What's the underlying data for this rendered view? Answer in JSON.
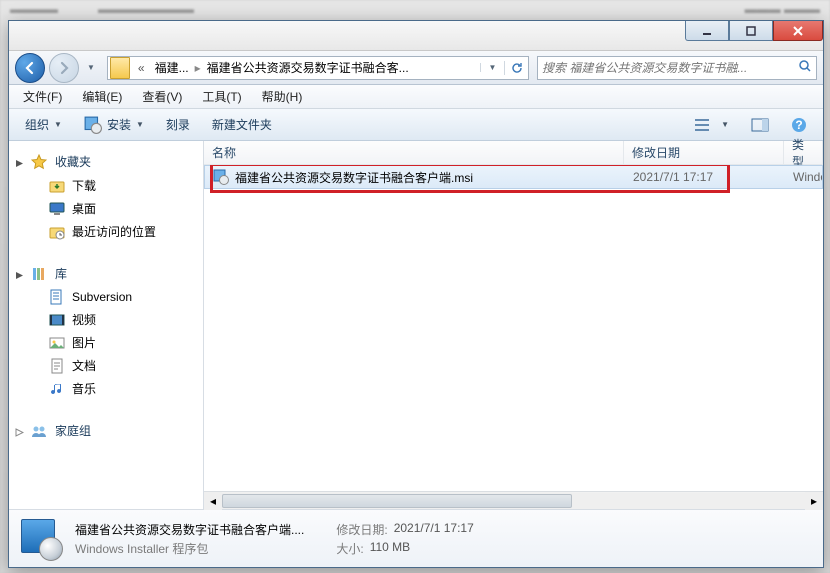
{
  "titlebar": {},
  "nav": {
    "crumb_prefix": "«",
    "crumb1": "福建...",
    "crumb2": "福建省公共资源交易数字证书融合客...",
    "search_placeholder": "搜索 福建省公共资源交易数字证书融..."
  },
  "menu": {
    "file": "文件(F)",
    "edit": "编辑(E)",
    "view": "查看(V)",
    "tools": "工具(T)",
    "help": "帮助(H)"
  },
  "toolbar": {
    "organize": "组织",
    "install": "安装",
    "burn": "刻录",
    "new_folder": "新建文件夹"
  },
  "sidebar": {
    "favorites": "收藏夹",
    "fav_items": {
      "0": {
        "label": "下载"
      },
      "1": {
        "label": "桌面"
      },
      "2": {
        "label": "最近访问的位置"
      }
    },
    "libraries": "库",
    "lib_items": {
      "0": {
        "label": "Subversion"
      },
      "1": {
        "label": "视频"
      },
      "2": {
        "label": "图片"
      },
      "3": {
        "label": "文档"
      },
      "4": {
        "label": "音乐"
      }
    },
    "homegroup": "家庭组"
  },
  "columns": {
    "name": "名称",
    "date": "修改日期",
    "type": "类型"
  },
  "files": {
    "0": {
      "name": "福建省公共资源交易数字证书融合客户端.msi",
      "date": "2021/7/1 17:17",
      "type": "Windo"
    }
  },
  "details": {
    "name": "福建省公共资源交易数字证书融合客户端....",
    "kind": "Windows Installer 程序包",
    "date_label": "修改日期:",
    "date": "2021/7/1 17:17",
    "size_label": "大小:",
    "size": "110 MB"
  }
}
